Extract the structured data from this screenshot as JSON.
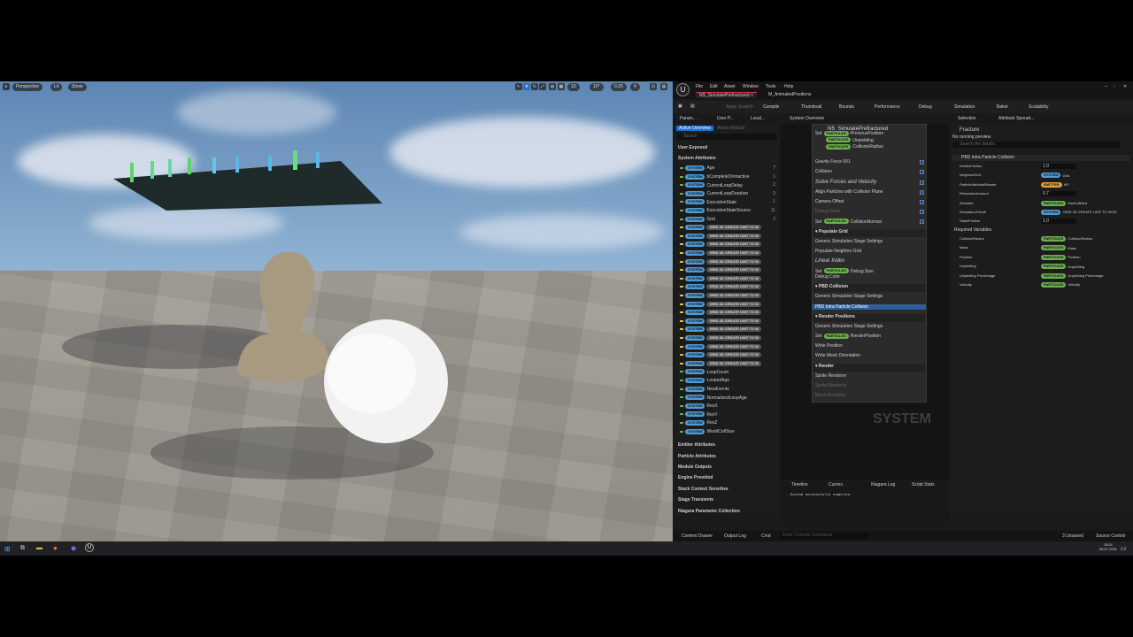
{
  "viewport": {
    "toolbar_left": [
      "Perspective",
      "Lit",
      "Show"
    ],
    "toolbar_right": [
      "10",
      "10°",
      "0.25",
      "4"
    ]
  },
  "menu": [
    "File",
    "Edit",
    "Asset",
    "Window",
    "Tools",
    "Help"
  ],
  "tabs": [
    "NS_SimulatePrefractured",
    "M_AnimatedPositions"
  ],
  "toolbar": [
    "Apply Scratch",
    "Compile",
    "Thumbnail",
    "Bounds",
    "Performance",
    "Debug",
    "Simulation",
    "Baker",
    "Scalability"
  ],
  "panel_tabs": [
    "Param...",
    "User P...",
    "Local...",
    "System Overview",
    "Selection",
    "Attribute Spread..."
  ],
  "params": {
    "search": "Search",
    "tabs": [
      "Active Overview",
      "Active Module"
    ],
    "sections": [
      "User Exposed",
      "System Attributes"
    ],
    "system_rows": [
      "Age",
      "bCompleteOnInactive",
      "CurrentLoopDelay",
      "CurrentLoopDuration",
      "ExecutionState",
      "ExecutionStateSource",
      "Grid"
    ],
    "grid_tag": "GRID 3D CREATE UNIT TO W",
    "grid_count": 17,
    "tail_rows": [
      "LoopCount",
      "LoopedAge",
      "NewEvents",
      "NormalizedLoopAge",
      "ResX",
      "ResY",
      "ResZ",
      "WorldCellSize"
    ],
    "counts": [
      "7",
      "1",
      "2",
      "3",
      "1",
      "11",
      "2"
    ],
    "footer": [
      "Emitter Attributes",
      "Particle Attributes",
      "Module Outputs",
      "Engine Provided",
      "Stack Context Sensitive",
      "Stage Transients",
      "Niagara Parameter Collection"
    ]
  },
  "overview": {
    "title": "NS_SimulatePrefractured",
    "set_rows": [
      "PreviousPosition",
      "Unyielding",
      "CollisionRadius"
    ],
    "items": [
      "Gravity Force 001",
      "Collision",
      "Solve Forces and Velocity",
      "Align Particles with Collision Plane",
      "Camera Offset",
      "Debug Draw",
      "CollisionNormal"
    ],
    "groups": [
      {
        "name": "Populate Grid",
        "rows": [
          "Generic Simulation Stage Settings",
          "Populate Neighbor Grid",
          "Linear Index",
          "Debug Size",
          "Debug Color"
        ]
      },
      {
        "name": "PBD Collision",
        "rows": [
          "Generic Simulation Stage Settings",
          "PBD Intra Particle Collision"
        ]
      },
      {
        "name": "Render Positions",
        "rows": [
          "Generic Simulation Stage Settings",
          "RenderPosition",
          "Write Position",
          "Write Mesh Orientation"
        ]
      },
      {
        "name": "Render",
        "rows": [
          "Sprite Renderer",
          "Sprite Renderer",
          "Mesh Renderer"
        ]
      }
    ],
    "system_label": "SYSTEM"
  },
  "log": {
    "tabs": [
      "Timeline",
      "Curves",
      "Niagara Log",
      "Script Stats"
    ],
    "message": "- System successfully compiled."
  },
  "selection": {
    "header": "Fracture",
    "sub": "No running preview.",
    "search": "Search the details",
    "group": "PBD Intra Particle Collision",
    "rows": [
      [
        "KineticFriction",
        "1.0"
      ],
      [
        "NeighborGrid",
        "Grid"
      ],
      [
        "ParticleAttributeReader",
        "AR"
      ],
      [
        "RelaxationAmount",
        "0.7"
      ],
      [
        "Simulate",
        "HasCollided"
      ],
      [
        "SimulationToUnit",
        "GRID 3D CREATE UNIT TO WOR"
      ],
      [
        "StaticFriction",
        "1.0"
      ]
    ],
    "required": "Required Variables",
    "req_rows": [
      [
        "CollisionRadius",
        "CollisionRadius"
      ],
      [
        "Mass",
        "Mass"
      ],
      [
        "Position",
        "Position"
      ],
      [
        "Unyielding",
        "Unyielding"
      ],
      [
        "Unyielding Percentage",
        "Unyielding Percentage"
      ],
      [
        "Velocity",
        "Velocity"
      ]
    ]
  },
  "statusbar": {
    "left": [
      "Content Drawer",
      "Output Log",
      "Cmd"
    ],
    "console": "Enter Console Command",
    "right": [
      "3 Unsaved",
      "Source Control"
    ]
  },
  "taskbar": {
    "time": "19:21",
    "date": "05.07.2021"
  }
}
